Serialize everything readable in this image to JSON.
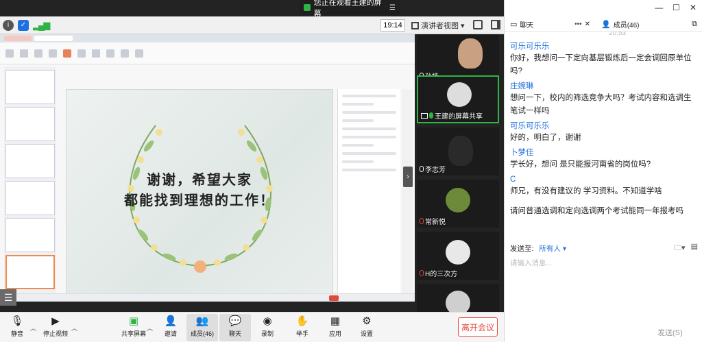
{
  "banner": {
    "text": "您正在观看王建的屏幕"
  },
  "toolbar": {
    "time": "19:14",
    "view_label": "演讲者视图"
  },
  "slide": {
    "line1": "谢谢，希望大家",
    "line2": "都能找到理想的工作！"
  },
  "participants": [
    {
      "name": "孙扬"
    },
    {
      "name": "王建的屏幕共享"
    },
    {
      "name": "李志芳"
    },
    {
      "name": "常新悦"
    },
    {
      "name": "H的三次方"
    }
  ],
  "bottom_bar": {
    "mute": "静音",
    "stop_video": "停止视频",
    "share": "共享屏幕",
    "invite": "邀请",
    "members": "成员(46)",
    "chat": "聊天",
    "record": "录制",
    "raise_hand": "举手",
    "apps": "应用",
    "settings": "设置",
    "leave": "离开会议"
  },
  "panel": {
    "chat_tab": "聊天",
    "members_tab": "成员(46)",
    "partial_time": "20:53"
  },
  "messages": [
    {
      "sender": "可乐可乐乐",
      "text": "你好，我想问一下定向基层锻炼后一定会调回原单位吗?"
    },
    {
      "sender": "庄婉琳",
      "text": "想问一下，校内的筛选竞争大吗？考试内容和选调生笔试一样吗"
    },
    {
      "sender": "可乐可乐乐",
      "text": "好的，明白了，谢谢"
    },
    {
      "sender": "卜梦佳",
      "text": "学长好，想问 是只能报河南省的岗位吗?"
    },
    {
      "sender": "C",
      "text": "师兄，有没有建议的 学习资料。不知道学啥"
    },
    {
      "sender": "",
      "text": "请问普通选调和定向选调两个考试能同一年报考吗"
    }
  ],
  "composer": {
    "send_to_label": "发送至:",
    "send_to_value": "所有人",
    "placeholder": "请输入消息...",
    "send_button": "发送(S)"
  },
  "colors": {
    "accent": "#1e6fe0",
    "active_green": "#2fb344",
    "leave_red": "#e24a3b"
  }
}
